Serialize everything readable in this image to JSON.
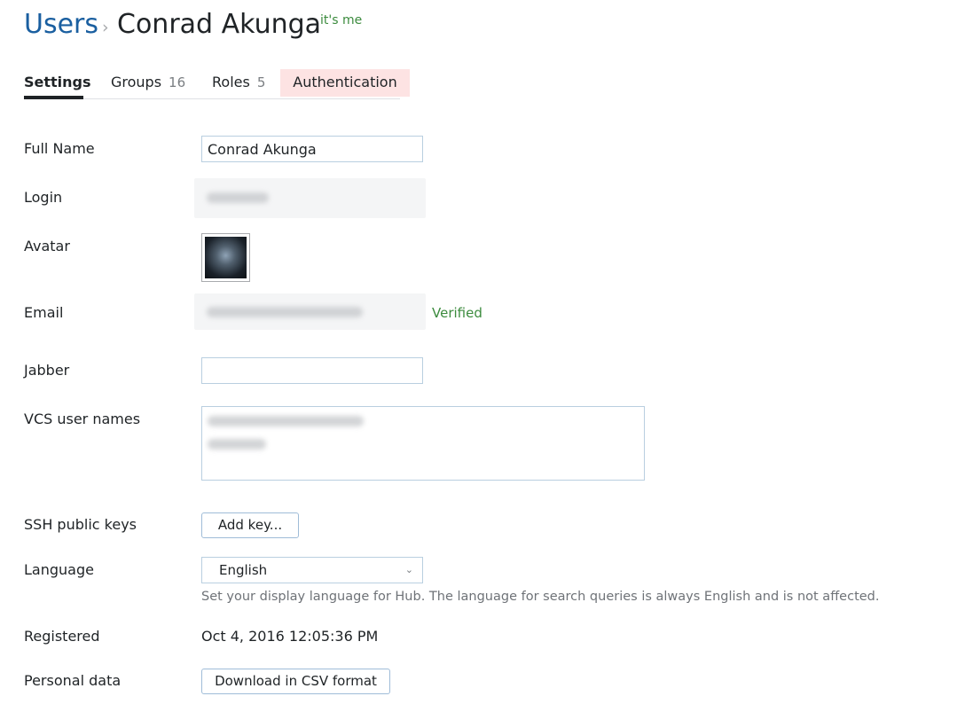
{
  "header": {
    "breadcrumb_root": "Users",
    "separator": "›",
    "title": "Conrad Akunga",
    "itsme": "it's me"
  },
  "tabs": [
    {
      "label": "Settings",
      "count": ""
    },
    {
      "label": "Groups",
      "count": "16"
    },
    {
      "label": "Roles",
      "count": "5"
    },
    {
      "label": "Authentication",
      "count": ""
    }
  ],
  "form": {
    "full_name_label": "Full Name",
    "full_name_value": "Conrad Akunga",
    "login_label": "Login",
    "avatar_label": "Avatar",
    "email_label": "Email",
    "email_status": "Verified",
    "jabber_label": "Jabber",
    "jabber_value": "",
    "vcs_label": "VCS user names",
    "ssh_label": "SSH public keys",
    "ssh_button": "Add key...",
    "language_label": "Language",
    "language_value": "English",
    "language_hint": "Set your display language for Hub. The language for search queries is always English and is not affected.",
    "registered_label": "Registered",
    "registered_value": "Oct 4, 2016 12:05:36 PM",
    "personal_label": "Personal data",
    "personal_button": "Download in CSV format"
  },
  "colors": {
    "link": "#1a5fa0",
    "verified": "#3c8b3e",
    "active_tab_highlight": "#fde3e3"
  },
  "icons": {
    "breadcrumb_separator": "chevron-right-icon",
    "select_arrow": "chevron-down-icon"
  }
}
